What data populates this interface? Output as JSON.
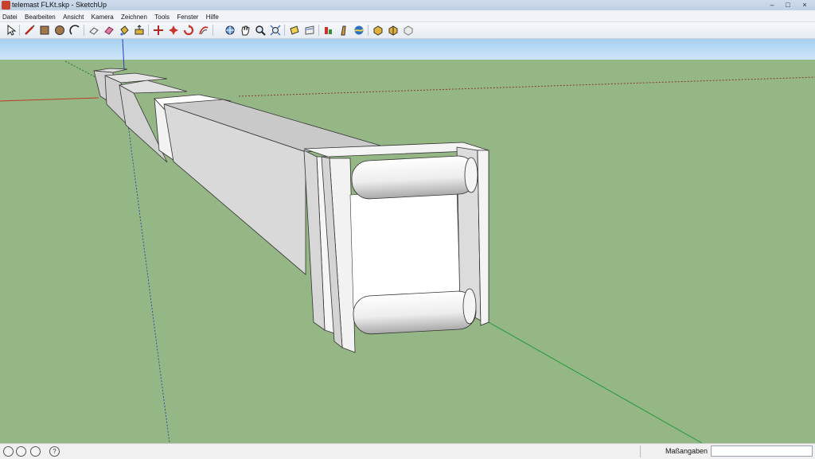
{
  "window": {
    "title": "telemast FLKt.skp - SketchUp",
    "minimize_glyph": "–",
    "maximize_glyph": "□",
    "close_glyph": "×"
  },
  "menu": [
    "Datei",
    "Bearbeiten",
    "Ansicht",
    "Kamera",
    "Zeichnen",
    "Tools",
    "Fenster",
    "Hilfe"
  ],
  "toolbar": {
    "tools": [
      "select-icon",
      "pencil-line-icon",
      "rectangle-icon",
      "circle-icon",
      "arc-icon",
      "eraser-outline-icon",
      "eraser-icon",
      "paint-bucket-icon",
      "push-pull-icon",
      "move-icon",
      "rotate-icon",
      "follow-me-icon",
      "offset-icon",
      "orbit-icon",
      "pan-icon",
      "zoom-icon",
      "zoom-extents-icon",
      "tape-measure-icon",
      "dimension-icon",
      "axes-icon",
      "section-plane-icon",
      "3d-warehouse-icon",
      "get-models-icon",
      "share-model-icon",
      "component-icon"
    ]
  },
  "status": {
    "help_glyph": "?",
    "measurements_label": "Maßangaben",
    "measurements_value": ""
  },
  "colors": {
    "sky": "#b9d9f2",
    "ground": "#95b785",
    "axis_red": "#c0392b",
    "axis_green": "#1f9a3a",
    "axis_blue": "#1f3fc0"
  }
}
